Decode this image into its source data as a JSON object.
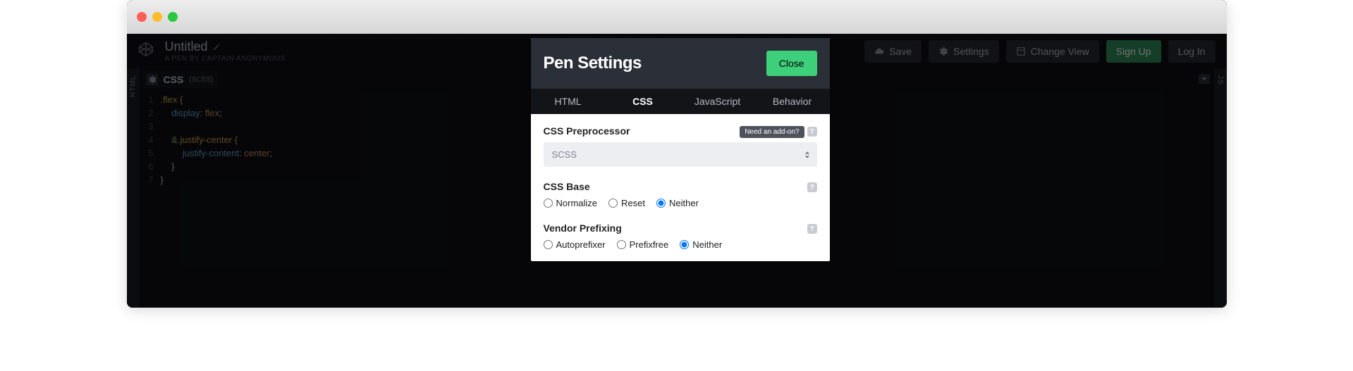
{
  "pen": {
    "title": "Untitled",
    "subtitle": "A PEN BY CAPTAIN ANONYMOUS"
  },
  "topButtons": {
    "save": "Save",
    "settings": "Settings",
    "changeView": "Change View",
    "signUp": "Sign Up",
    "logIn": "Log In"
  },
  "sideTabs": {
    "left": "HTML",
    "right": "JS"
  },
  "editor": {
    "title": "CSS",
    "sub": "(SCSS)",
    "lines": {
      "l1": ".flex {",
      "l2_prop": "display",
      "l2_val": "flex",
      "l4_amp": "&",
      "l4_sel": ".justify-center {",
      "l5_prop": "justify-content",
      "l5_val": "center"
    }
  },
  "modal": {
    "title": "Pen Settings",
    "close": "Close",
    "tabs": {
      "html": "HTML",
      "css": "CSS",
      "js": "JavaScript",
      "behavior": "Behavior"
    },
    "preprocessor": {
      "heading": "CSS Preprocessor",
      "addon": "Need an add-on?",
      "selected": "SCSS"
    },
    "base": {
      "heading": "CSS Base",
      "opts": {
        "normalize": "Normalize",
        "reset": "Reset",
        "neither": "Neither"
      }
    },
    "prefix": {
      "heading": "Vendor Prefixing",
      "opts": {
        "autoprefixer": "Autoprefixer",
        "prefixfree": "Prefixfree",
        "neither": "Neither"
      }
    }
  }
}
